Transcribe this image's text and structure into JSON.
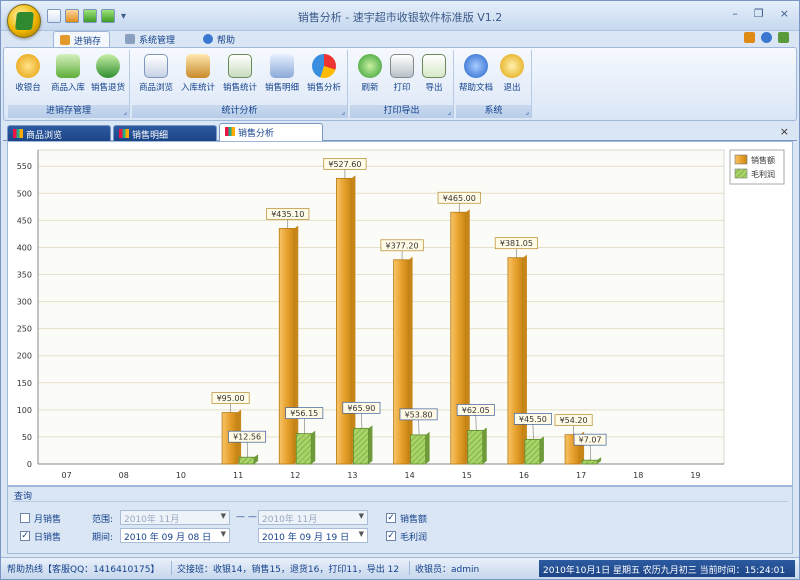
{
  "window": {
    "title": "销售分析 - 速宇超市收银软件标准版 V1.2",
    "minimize": "–",
    "restore": "❐",
    "close": "×"
  },
  "ribbon_tabs": [
    {
      "label": "进销存",
      "active": true
    },
    {
      "label": "系统管理",
      "active": false
    },
    {
      "label": "帮助",
      "active": false
    }
  ],
  "groups": [
    {
      "label": "进销存管理",
      "buttons": [
        "收银台",
        "商品入库",
        "销售退货"
      ]
    },
    {
      "label": "统计分析",
      "buttons": [
        "商品浏览",
        "入库统计",
        "销售统计",
        "销售明细",
        "销售分析"
      ]
    },
    {
      "label": "打印导出",
      "buttons": [
        "刷新",
        "打印",
        "导出"
      ]
    },
    {
      "label": "系统",
      "buttons": [
        "帮助文档",
        "退出"
      ]
    }
  ],
  "doc_tabs": [
    {
      "label": "商品浏览",
      "active": false
    },
    {
      "label": "销售明细",
      "active": false
    },
    {
      "label": "销售分析",
      "active": true
    }
  ],
  "chart_data": {
    "type": "bar",
    "categories": [
      "07",
      "08",
      "10",
      "11",
      "12",
      "13",
      "14",
      "15",
      "16",
      "17",
      "18",
      "19"
    ],
    "series": [
      {
        "name": "销售额",
        "color": "#e8a22f",
        "values": [
          0,
          0,
          0,
          95.0,
          435.1,
          527.6,
          377.2,
          465.0,
          381.05,
          54.2,
          0,
          0
        ],
        "labels": [
          "",
          "",
          "",
          "¥95.00",
          "¥435.10",
          "¥527.60",
          "¥377.20",
          "¥465.00",
          "¥381.05",
          "¥54.20",
          "",
          ""
        ]
      },
      {
        "name": "毛利润",
        "color": "#8fc34a",
        "values": [
          0,
          0,
          0,
          12.56,
          56.15,
          65.9,
          53.8,
          62.05,
          45.5,
          7.07,
          0,
          0
        ],
        "labels": [
          "",
          "",
          "",
          "¥12.56",
          "¥56.15",
          "¥65.90",
          "¥53.80",
          "¥62.05",
          "¥45.50",
          "¥7.07",
          "",
          ""
        ]
      }
    ],
    "ylim": [
      0,
      580
    ],
    "yticks": [
      0,
      50,
      100,
      150,
      200,
      250,
      300,
      350,
      400,
      450,
      500,
      550
    ],
    "grid": true,
    "legend": "top-right"
  },
  "filter": {
    "title": "查询",
    "by_month_label": "月销售",
    "by_day_label": "日销售",
    "range_label": "范围:",
    "period_label": "期间:",
    "month_from": "2010年 11月",
    "month_to": "2010年 11月",
    "dash": "— —",
    "date_from": "2010 年 09 月 08 日",
    "date_to": "2010 年 09 月 19 日",
    "show_sales_label": "销售额",
    "show_profit_label": "毛利润"
  },
  "status": {
    "help": "帮助热线【客服QQ：1416410175】",
    "stats": "交接班：收银14，销售15，退货16，打印11，导出 12",
    "cashier": "收银员：admin",
    "clock": "2010年10月1日 星期五 农历九月初三 当前时间：15:24:01"
  },
  "colors": {
    "ribbon_blue": "#15428b",
    "sales_bar": "#e8a22f",
    "profit_bar": "#8fc34a"
  }
}
